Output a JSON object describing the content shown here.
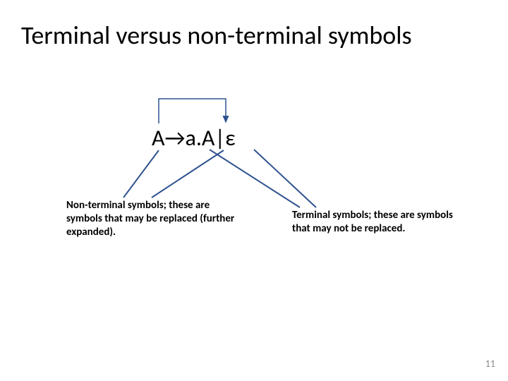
{
  "title": "Terminal versus non-terminal symbols",
  "rule": {
    "A1": "A",
    "arrow": " → ",
    "a": "a.",
    "A2": "A",
    "bar": " | ",
    "eps": "ε"
  },
  "annotations": {
    "nonterminal": "Non-terminal symbols; these are symbols that may be replaced (further expanded).",
    "terminal": "Terminal symbols; these are symbols that may not be replaced."
  },
  "colors": {
    "arrow_blue": "#4472c4",
    "arrow_stroke": "#2f528f"
  },
  "page_number": "11"
}
